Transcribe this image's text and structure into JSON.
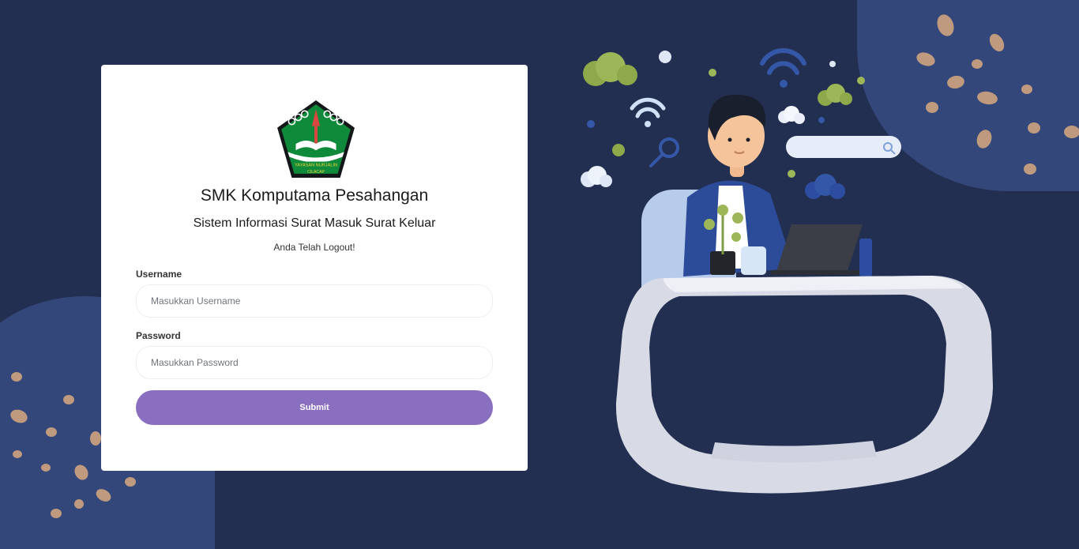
{
  "page": {
    "school_name": "SMK Komputama Pesahangan",
    "system_name": "Sistem Informasi Surat Masuk Surat Keluar",
    "status_message": "Anda Telah Logout!"
  },
  "logo": {
    "text_top": "YAYASAN NURJALIN",
    "text_bottom": "CILACAP"
  },
  "form": {
    "username_label": "Username",
    "username_placeholder": "Masukkan Username",
    "username_value": "",
    "password_label": "Password",
    "password_placeholder": "Masukkan Password",
    "password_value": "",
    "submit_label": "Submit"
  },
  "icons": [
    "school-logo",
    "search-bar-icon",
    "wifi-icon",
    "cloud-icon",
    "magnifier-icon"
  ],
  "colors": {
    "background": "#232f51",
    "blob": "#33477a",
    "dot": "#c09a7e",
    "submit": "#8a6fc1",
    "card": "#ffffff"
  }
}
